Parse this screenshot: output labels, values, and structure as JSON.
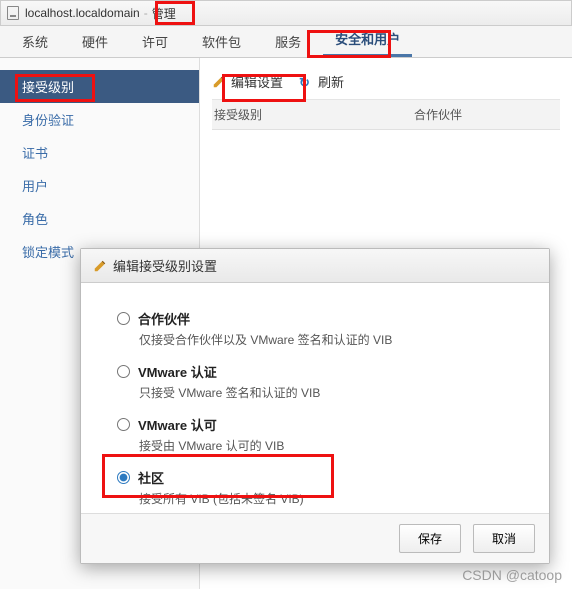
{
  "titlebar": {
    "host": "localhost.localdomain",
    "section": "管理"
  },
  "tabs": {
    "t0": "系统",
    "t1": "硬件",
    "t2": "许可",
    "t3": "软件包",
    "t4": "服务",
    "t5": "安全和用户"
  },
  "sidebar": {
    "items": [
      {
        "label": "接受级别"
      },
      {
        "label": "身份验证"
      },
      {
        "label": "证书"
      },
      {
        "label": "用户"
      },
      {
        "label": "角色"
      },
      {
        "label": "锁定模式"
      }
    ]
  },
  "toolbar": {
    "edit": "编辑设置",
    "refresh": "刷新"
  },
  "info": {
    "col1": "接受级别",
    "col2": "合作伙伴"
  },
  "dialog": {
    "title": "编辑接受级别设置",
    "options": [
      {
        "label": "合作伙伴",
        "desc": "仅接受合作伙伴以及 VMware 签名和认证的 VIB"
      },
      {
        "label": "VMware 认证",
        "desc": "只接受 VMware 签名和认证的 VIB"
      },
      {
        "label": "VMware 认可",
        "desc": "接受由 VMware 认可的 VIB"
      },
      {
        "label": "社区",
        "desc": "接受所有 VIB (包括未签名 VIB)"
      }
    ],
    "save": "保存",
    "cancel": "取消"
  },
  "watermark": "CSDN @catoop"
}
